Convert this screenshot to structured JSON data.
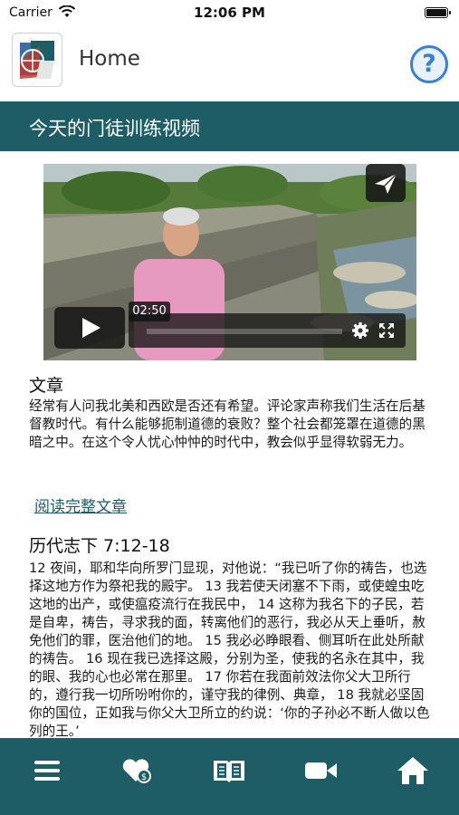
{
  "status_bar": {
    "carrier": "Carrier",
    "time": "12:06 PM"
  },
  "header": {
    "title": "Home",
    "help_symbol": "?"
  },
  "section": {
    "title": "今天的门徒训练视频"
  },
  "video": {
    "current_time": "02:50",
    "controls": [
      "play-icon",
      "settings-gear-icon",
      "fullscreen-icon",
      "share-send-icon"
    ]
  },
  "article": {
    "heading": "文章",
    "body": "经常有人问我北美和西欧是否还有希望。评论家声称我们生活在后基督教时代。有什么能够扼制道德的衰败？整个社会都笼罩在道德的黑暗之中。在这个令人忧心忡忡的时代中，教会似乎显得软弱无力。",
    "read_more": "阅读完整文章"
  },
  "scripture": {
    "reference": "历代志下 7:12-18",
    "text": "12 夜间，耶和华向所罗门显现，对他说：“我已听了你的祷告，也选择这地方作为祭祀我的殿宇。 13 我若使天闭塞不下雨，或使蝗虫吃这地的出产，或使瘟疫流行在我民中， 14 这称为我名下的子民，若是自卑，祷告，寻求我的面，转离他们的恶行，我必从天上垂听，赦免他们的罪，医治他们的地。 15 我必必睁眼看、侧耳听在此处所献的祷告。 16 现在我已选择这殿，分别为圣，使我的名永在其中，我的眼、我的心也必常在那里。 17 你若在我面前效法你父大卫所行的，遵行我一切所吩咐你的，谨守我的律例、典章， 18 我就必坚固你的国位，正如我与你父大卫所立的约说：‘你的子孙必不断人做以色列的王。’"
  },
  "bottom_nav": {
    "items": [
      "menu-icon",
      "giving-heart-icon",
      "bible-book-icon",
      "video-camera-icon",
      "home-icon"
    ]
  },
  "colors": {
    "brand_teal": "#1f5d66",
    "help_blue": "#3b7fd3"
  }
}
